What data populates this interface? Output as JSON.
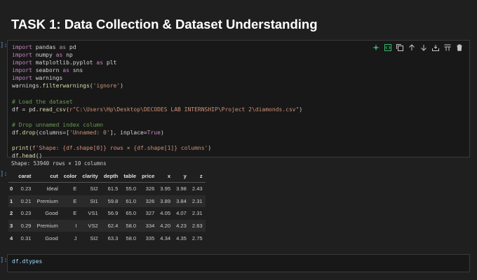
{
  "heading": "TASK 1: Data Collection & Dataset Understanding",
  "cell1": {
    "prompt": "]:",
    "lines": [
      [
        [
          "kw",
          "import"
        ],
        [
          "",
          ""
        ],
        [
          "plain",
          " pandas "
        ],
        [
          "kw",
          "as"
        ],
        [
          "plain",
          " pd"
        ]
      ],
      [
        [
          "kw",
          "import"
        ],
        [
          "plain",
          " numpy "
        ],
        [
          "kw",
          "as"
        ],
        [
          "plain",
          " np"
        ]
      ],
      [
        [
          "kw",
          "import"
        ],
        [
          "plain",
          " matplotlib.pyplot "
        ],
        [
          "kw",
          "as"
        ],
        [
          "plain",
          " plt"
        ]
      ],
      [
        [
          "kw",
          "import"
        ],
        [
          "plain",
          " seaborn "
        ],
        [
          "kw",
          "as"
        ],
        [
          "plain",
          " sns"
        ]
      ],
      [
        [
          "kw",
          "import"
        ],
        [
          "plain",
          " warnings"
        ]
      ],
      [
        [
          "plain",
          "warnings."
        ],
        [
          "fn",
          "filterwarnings"
        ],
        [
          "plain",
          "("
        ],
        [
          "str",
          "'ignore'"
        ],
        [
          "plain",
          ")"
        ]
      ],
      [
        [
          "plain",
          ""
        ]
      ],
      [
        [
          "cm",
          "# Load the dataset"
        ]
      ],
      [
        [
          "plain",
          "df = pd."
        ],
        [
          "fn",
          "read_csv"
        ],
        [
          "plain",
          "("
        ],
        [
          "str",
          "r\"C:\\Users\\Hp\\Desktop\\DECODES LAB INTERNSHIP\\Project 2\\diamonds.csv\""
        ],
        [
          "plain",
          ")"
        ]
      ],
      [
        [
          "plain",
          ""
        ]
      ],
      [
        [
          "cm",
          "# Drop unnamed index column"
        ]
      ],
      [
        [
          "plain",
          "df."
        ],
        [
          "fn",
          "drop"
        ],
        [
          "plain",
          "(columns=["
        ],
        [
          "str",
          "'Unnamed: 0'"
        ],
        [
          "plain",
          "], inplace="
        ],
        [
          "kw",
          "True"
        ],
        [
          "plain",
          ")"
        ]
      ],
      [
        [
          "plain",
          ""
        ]
      ],
      [
        [
          "fn",
          "print"
        ],
        [
          "plain",
          "("
        ],
        [
          "str",
          "f'Shape: {df.shape[0]} rows × {df.shape[1]} columns'"
        ],
        [
          "plain",
          ")"
        ]
      ],
      [
        [
          "plain",
          "df."
        ],
        [
          "fn",
          "head"
        ],
        [
          "plain",
          "()"
        ]
      ]
    ],
    "output_text": "Shape: 53940 rows × 10 columns",
    "output_prompt": "]:"
  },
  "toolbar": {
    "icons": [
      "sparkle-run-icon",
      "code-icon",
      "copy-icon",
      "arrow-up-icon",
      "arrow-down-icon",
      "split-cell-icon",
      "clear-output-icon",
      "delete-icon"
    ]
  },
  "table": {
    "columns": [
      "",
      "carat",
      "cut",
      "color",
      "clarity",
      "depth",
      "table",
      "price",
      "x",
      "y",
      "z"
    ],
    "rows": [
      [
        "0",
        "0.23",
        "Ideal",
        "E",
        "SI2",
        "61.5",
        "55.0",
        "326",
        "3.95",
        "3.98",
        "2.43"
      ],
      [
        "1",
        "0.21",
        "Premium",
        "E",
        "SI1",
        "59.8",
        "61.0",
        "326",
        "3.89",
        "3.84",
        "2.31"
      ],
      [
        "2",
        "0.23",
        "Good",
        "E",
        "VS1",
        "56.9",
        "65.0",
        "327",
        "4.05",
        "4.07",
        "2.31"
      ],
      [
        "3",
        "0.29",
        "Premium",
        "I",
        "VS2",
        "62.4",
        "58.0",
        "334",
        "4.20",
        "4.23",
        "2.63"
      ],
      [
        "4",
        "0.31",
        "Good",
        "J",
        "SI2",
        "63.3",
        "58.0",
        "335",
        "4.34",
        "4.35",
        "2.75"
      ]
    ]
  },
  "cell2": {
    "prompt": "]:",
    "code": "df.dtypes"
  }
}
